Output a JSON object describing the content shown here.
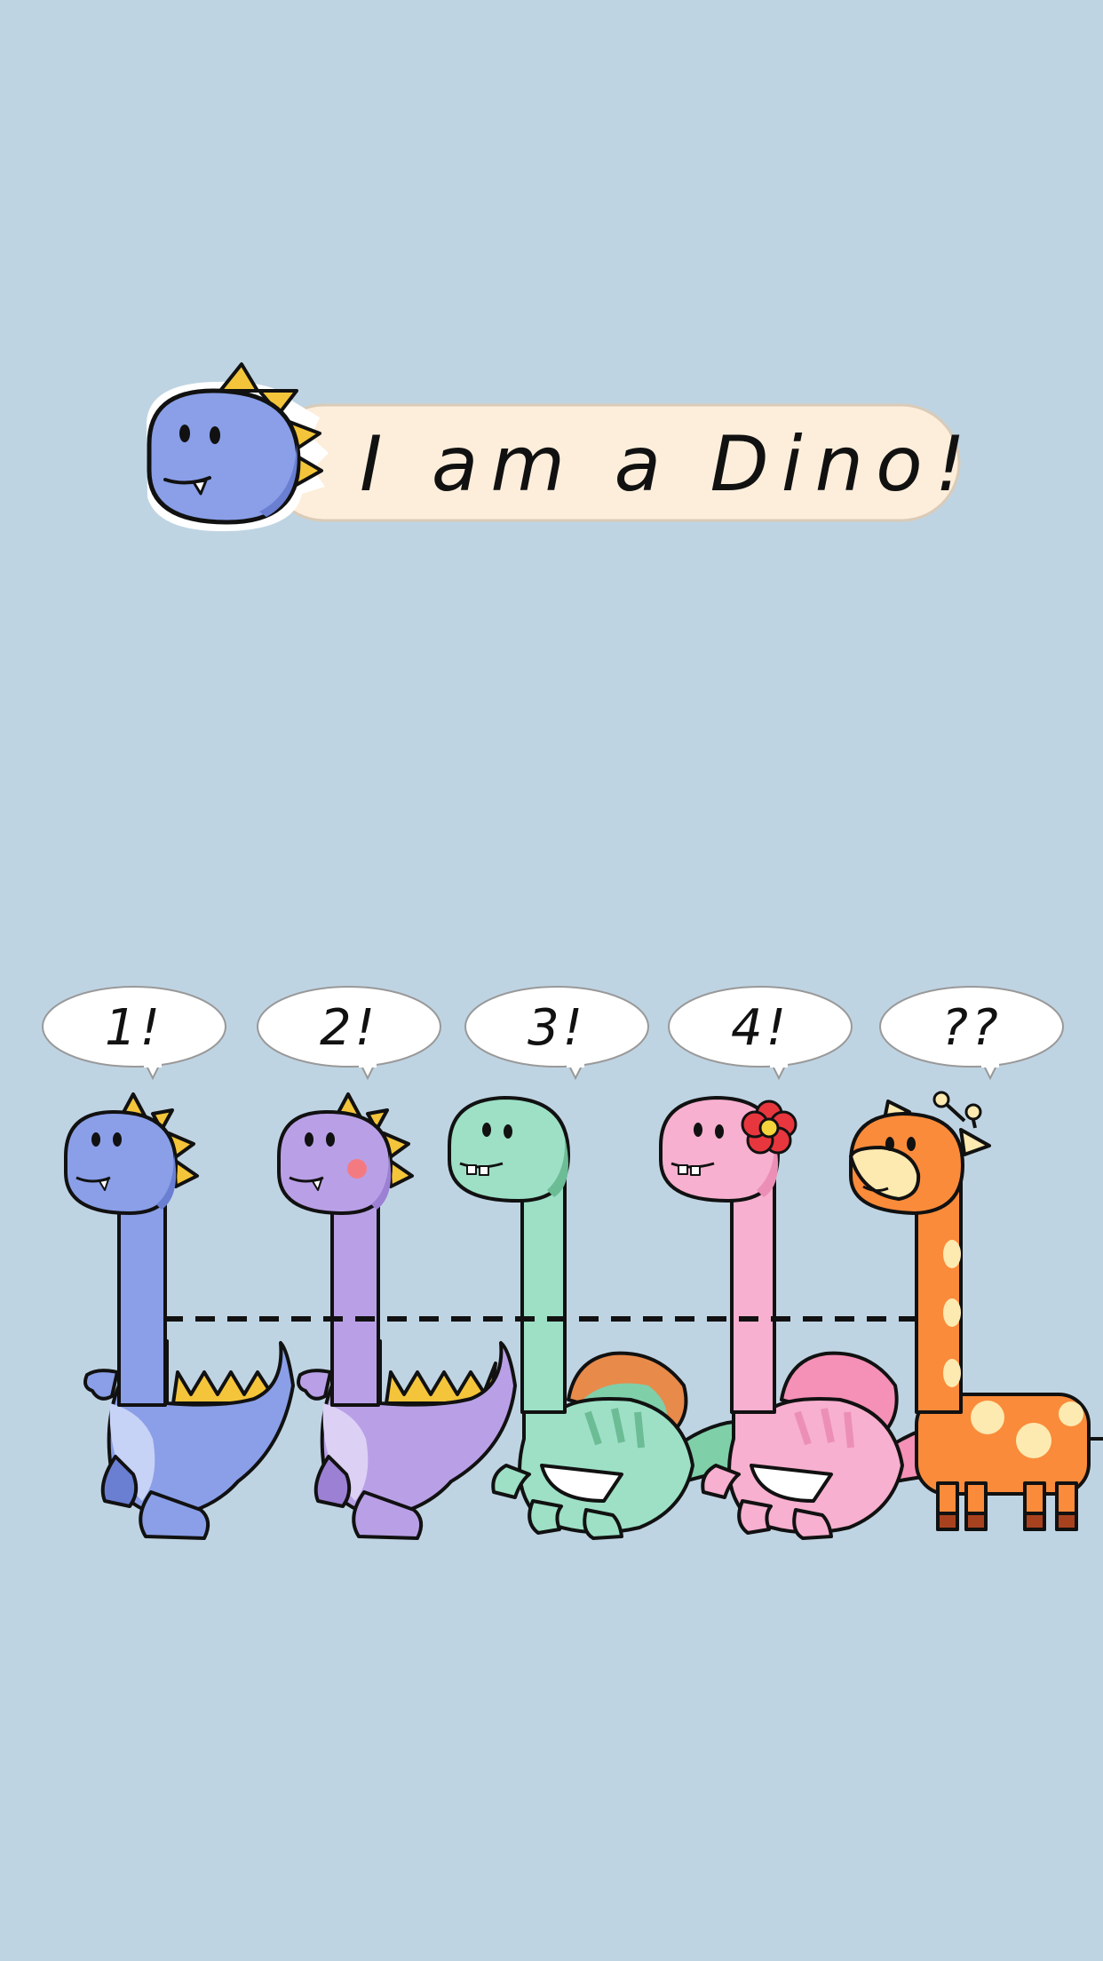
{
  "title": "I am a Dino!",
  "bubbles": [
    "1!",
    "2!",
    "3!",
    "4!",
    "??"
  ],
  "colors": {
    "background": "#bfd4e3",
    "banner": "#fdeedb",
    "blue_dino": "#8a9fe8",
    "purple_dino": "#b9a0e6",
    "green_dino": "#9de0c6",
    "pink_dino": "#f7b0cf",
    "giraffe": "#fa8b3a",
    "spikes": "#f4c53a"
  }
}
